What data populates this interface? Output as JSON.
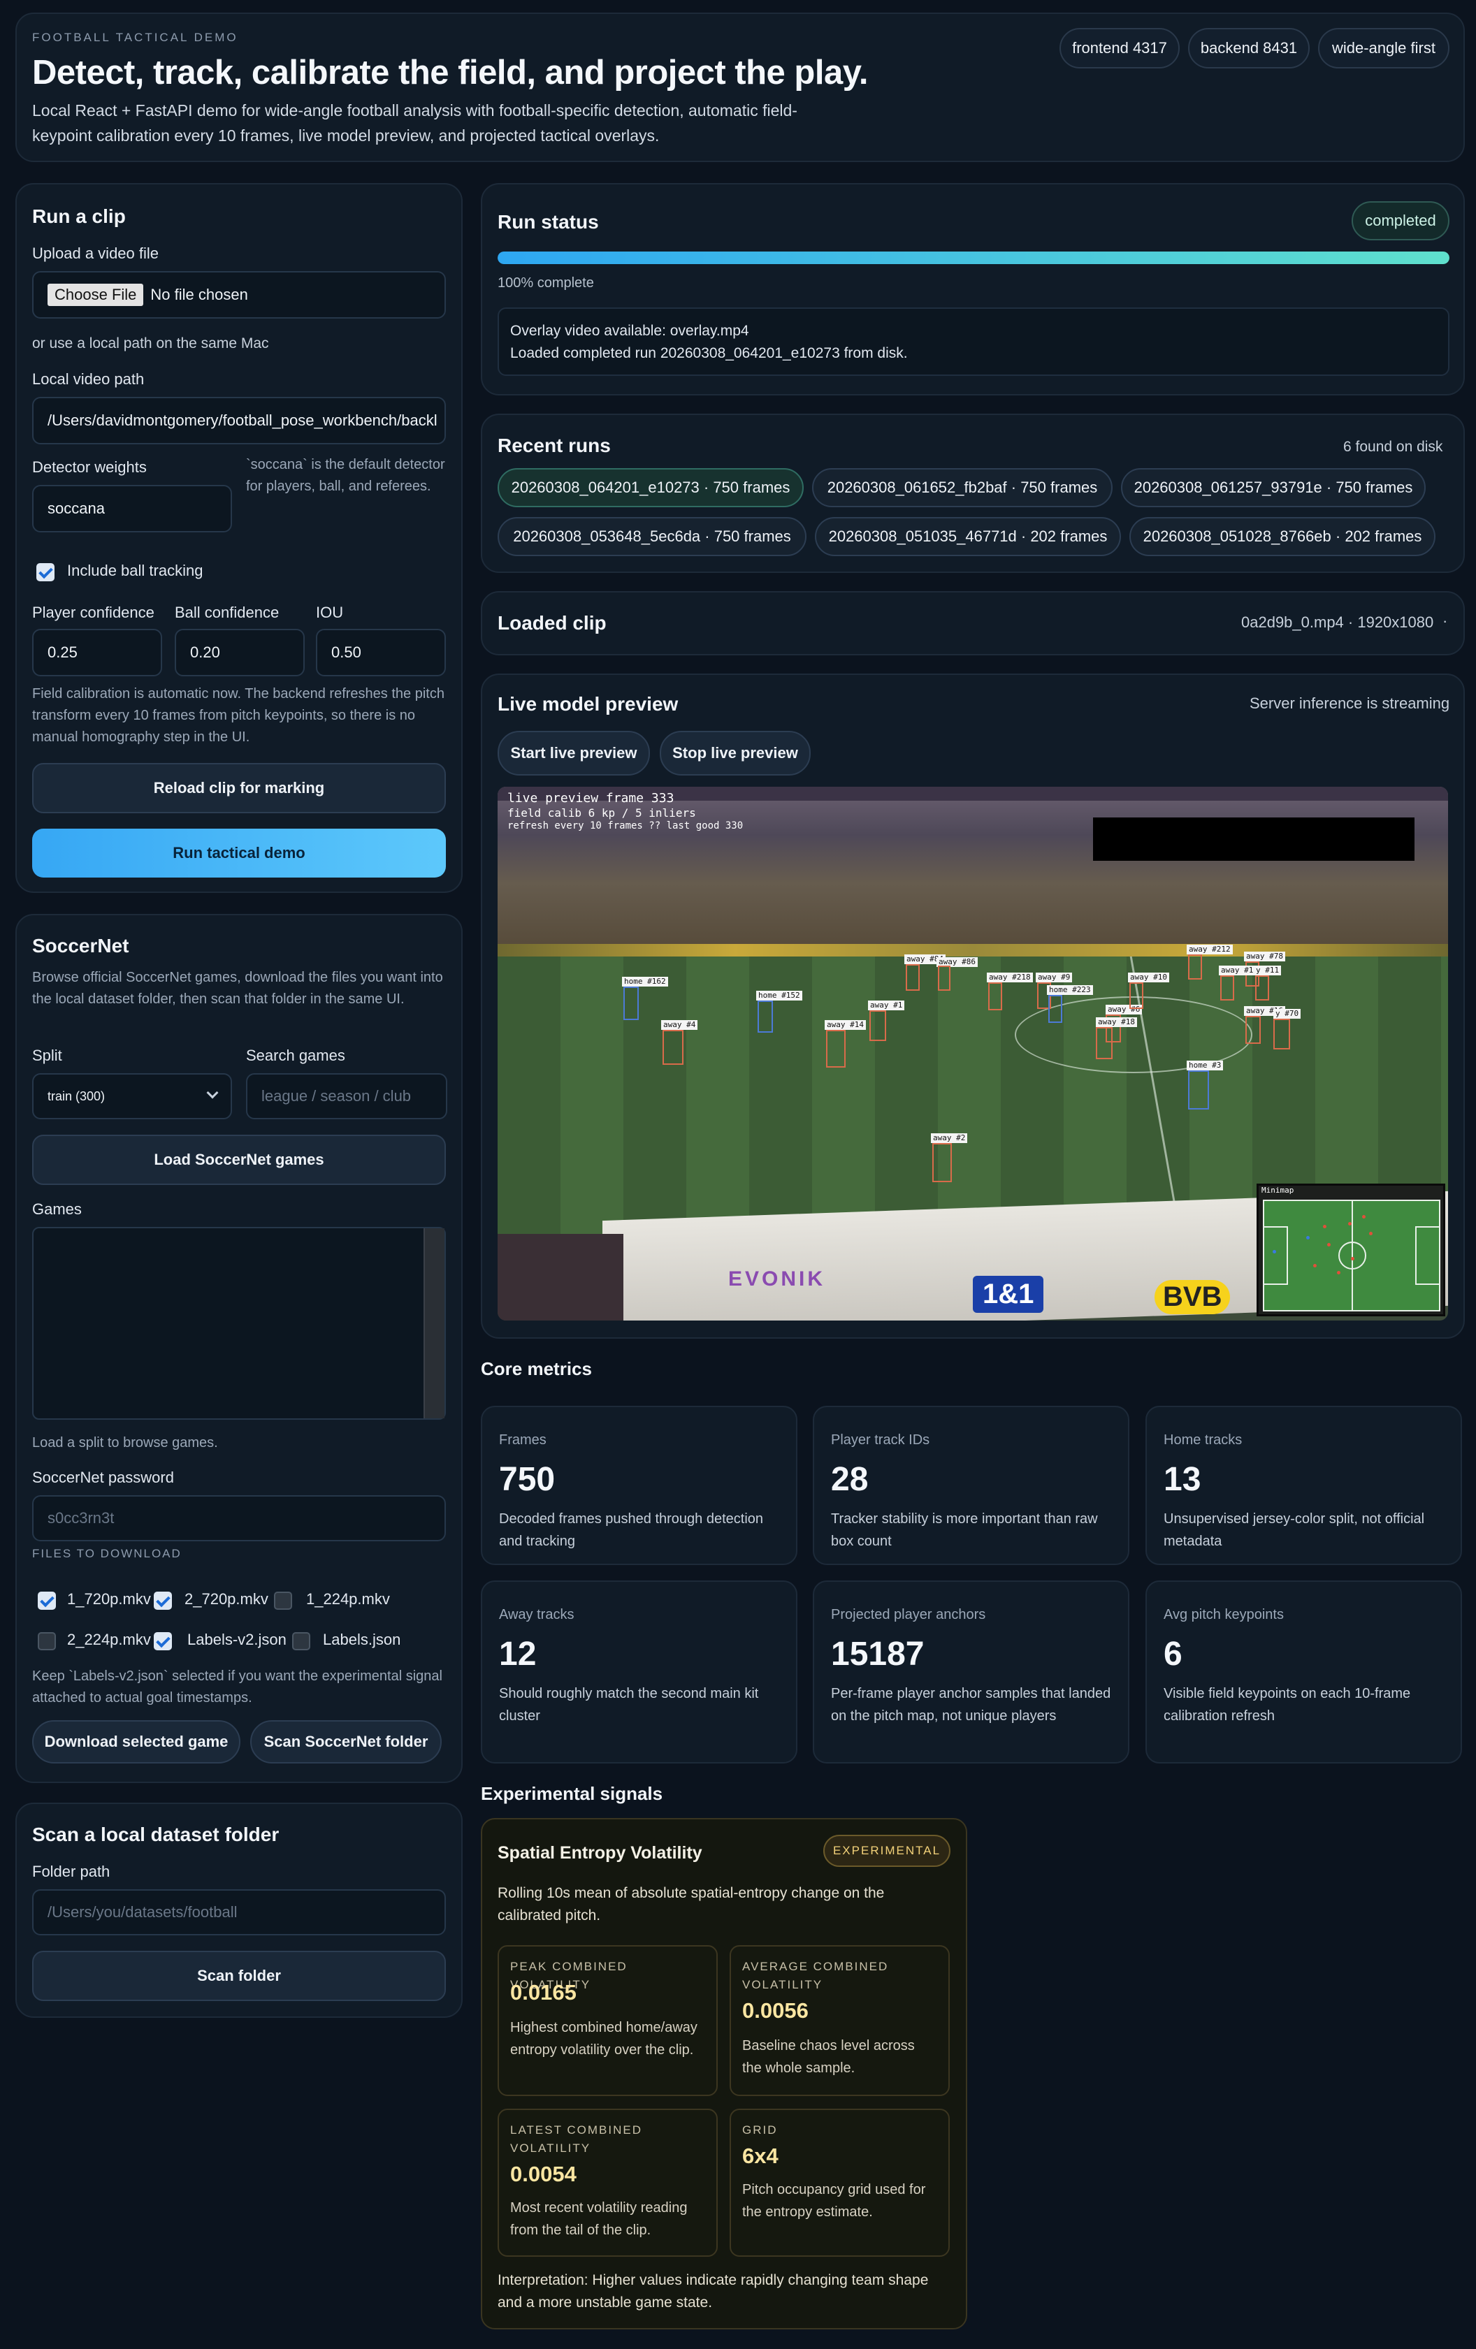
{
  "header": {
    "eyebrow": "FOOTBALL TACTICAL DEMO",
    "title": "Detect, track, calibrate the field, and project the play.",
    "lead": "Local React + FastAPI demo for wide-angle football analysis with football-specific detection, automatic field-keypoint calibration every 10 frames, live model preview, and projected tactical overlays.",
    "pills": [
      "frontend 4317",
      "backend 8431",
      "wide-angle first"
    ]
  },
  "run_clip": {
    "title": "Run a clip",
    "upload_label": "Upload a video file",
    "choose_file": "Choose File",
    "no_file": "No file chosen",
    "or_local": "or use a local path on the same Mac",
    "local_label": "Local video path",
    "local_value": "/Users/davidmontgomery/football_pose_workbench/backl",
    "weights_label": "Detector weights",
    "weights_value": "soccana",
    "weights_note": "`soccana` is the default detector for players, ball, and referees.",
    "ball_tracking_label": "Include ball tracking",
    "player_conf_label": "Player confidence",
    "player_conf_value": "0.25",
    "ball_conf_label": "Ball confidence",
    "ball_conf_value": "0.20",
    "iou_label": "IOU",
    "iou_value": "0.50",
    "calib_note": "Field calibration is automatic now. The backend refreshes the pitch transform every 10 frames from pitch keypoints, so there is no manual homography step in the UI.",
    "reload_button": "Reload clip for marking",
    "run_button": "Run tactical demo"
  },
  "soccernet": {
    "title": "SoccerNet",
    "desc": "Browse official SoccerNet games, download the files you want into the local dataset folder, then scan that folder in the same UI.",
    "split_label": "Split",
    "split_value": "train (300)",
    "search_label": "Search games",
    "search_placeholder": "league / season / club",
    "load_button": "Load SoccerNet games",
    "games_label": "Games",
    "games_hint": "Load a split to browse games.",
    "password_label": "SoccerNet password",
    "password_placeholder": "s0cc3rn3t",
    "files_label": "FILES TO DOWNLOAD",
    "files": [
      "1_720p.mkv",
      "2_720p.mkv",
      "1_224p.mkv",
      "2_224p.mkv",
      "Labels-v2.json",
      "Labels.json"
    ],
    "files_note": "Keep `Labels-v2.json` selected if you want the experimental signal attached to actual goal timestamps.",
    "download_button": "Download selected game",
    "scan_button": "Scan SoccerNet folder"
  },
  "local_scan": {
    "title": "Scan a local dataset folder",
    "folder_label": "Folder path",
    "folder_placeholder": "/Users/you/datasets/football",
    "scan_button": "Scan folder"
  },
  "run_status": {
    "title": "Run status",
    "badge": "completed",
    "progress": 1.0,
    "progress_text": "100% complete",
    "line1": "Overlay video available: overlay.mp4",
    "line2": "Loaded completed run 20260308_064201_e10273 from disk."
  },
  "recent_runs": {
    "title": "Recent runs",
    "count": "6 found on disk",
    "runs": [
      "20260308_064201_e10273 · 750 frames",
      "20260308_061652_fb2baf · 750 frames",
      "20260308_061257_93791e · 750 frames",
      "20260308_053648_5ec6da · 750 frames",
      "20260308_051035_46771d · 202 frames",
      "20260308_051028_8766eb · 202 frames"
    ]
  },
  "loaded_clip": {
    "title": "Loaded clip",
    "value": "0a2d9b_0.mp4 · 1920x1080",
    "arrow": "·"
  },
  "live_preview": {
    "title": "Live model preview",
    "status": "Server inference is streaming",
    "start_button": "Start live preview",
    "stop_button": "Stop live preview",
    "overlay_lines": [
      "live preview frame 333",
      "field calib 6 kp / 5 inliers",
      "refresh every 10 frames ?? last good 330"
    ],
    "minimap_label": "Minimap",
    "boards": [
      "EVONIK",
      "1&1",
      "BVB"
    ],
    "player_tags": [
      "home #162",
      "away #4",
      "home #152",
      "away #14",
      "away #1",
      "away #84",
      "away #86",
      "away #218",
      "away #9",
      "home #223",
      "away #6",
      "away #18",
      "away #10",
      "away #212",
      "away #78",
      "away #12",
      "y #11",
      "away #16",
      "y #70",
      "home #3",
      "away #2"
    ]
  },
  "core_metrics": {
    "title": "Core metrics",
    "items": [
      {
        "label": "Frames",
        "value": "750",
        "desc": "Decoded frames pushed through detection and tracking"
      },
      {
        "label": "Player track IDs",
        "value": "28",
        "desc": "Tracker stability is more important than raw box count"
      },
      {
        "label": "Home tracks",
        "value": "13",
        "desc": "Unsupervised jersey-color split, not official metadata"
      },
      {
        "label": "Away tracks",
        "value": "12",
        "desc": "Should roughly match the second main kit cluster"
      },
      {
        "label": "Projected player anchors",
        "value": "15187",
        "desc": "Per-frame player anchor samples that landed on the pitch map, not unique players"
      },
      {
        "label": "Avg pitch keypoints",
        "value": "6",
        "desc": "Visible field keypoints on each 10-frame calibration refresh"
      }
    ]
  },
  "experimental": {
    "section_title": "Experimental signals",
    "card_title": "Spatial Entropy Volatility",
    "badge": "EXPERIMENTAL",
    "desc": "Rolling 10s mean of absolute spatial-entropy change on the calibrated pitch.",
    "items": [
      {
        "label": "PEAK COMBINED VOLATILITY",
        "value": "0.0165",
        "desc": "Highest combined home/away entropy volatility over the clip."
      },
      {
        "label": "AVERAGE COMBINED VOLATILITY",
        "value": "0.0056",
        "desc": "Baseline chaos level across the whole sample."
      },
      {
        "label": "LATEST COMBINED VOLATILITY",
        "value": "0.0054",
        "desc": "Most recent volatility reading from the tail of the clip."
      },
      {
        "label": "GRID",
        "value": "6x4",
        "desc": "Pitch occupancy grid used for the entropy estimate."
      }
    ],
    "interpretation": "Interpretation: Higher values indicate rapidly changing team shape and a more unstable game state."
  }
}
